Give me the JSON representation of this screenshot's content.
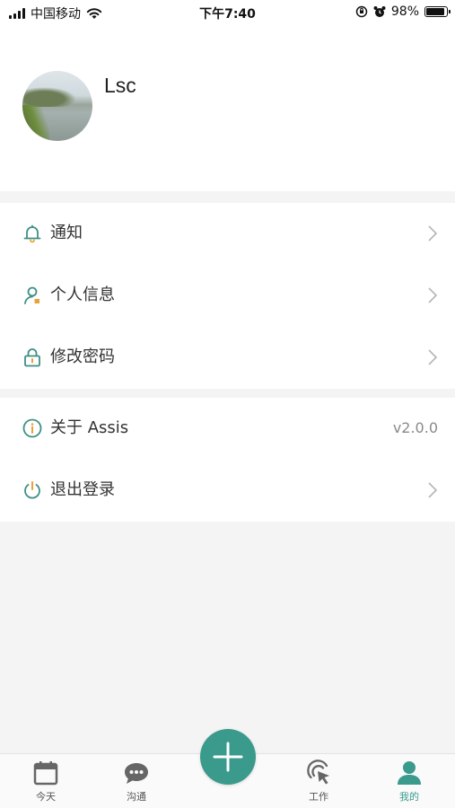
{
  "status_bar": {
    "carrier": "中国移动",
    "time": "下午7:40",
    "battery_percent": "98%",
    "battery_level": 0.98
  },
  "profile": {
    "username": "Lsc"
  },
  "menu": {
    "group1": [
      {
        "label": "通知",
        "icon": "bell-icon"
      },
      {
        "label": "个人信息",
        "icon": "user-icon"
      },
      {
        "label": "修改密码",
        "icon": "lock-icon"
      }
    ],
    "group2": [
      {
        "label": "关于 Assis",
        "icon": "info-icon",
        "value": "v2.0.0"
      },
      {
        "label": "退出登录",
        "icon": "power-icon"
      }
    ]
  },
  "tabbar": {
    "tabs": [
      {
        "label": "今天",
        "icon": "calendar-icon"
      },
      {
        "label": "沟通",
        "icon": "chat-bubble-icon"
      },
      {
        "label": "工作",
        "icon": "cursor-click-icon"
      },
      {
        "label": "我的",
        "icon": "person-icon"
      }
    ],
    "active": "我的",
    "fab_icon": "plus-icon"
  },
  "colors": {
    "accent": "#3a9a8c",
    "icon_teal": "#3f8f86",
    "background": "#f4f4f4",
    "chevron": "#b5b5b5",
    "icon_orange": "#e8a23a"
  }
}
